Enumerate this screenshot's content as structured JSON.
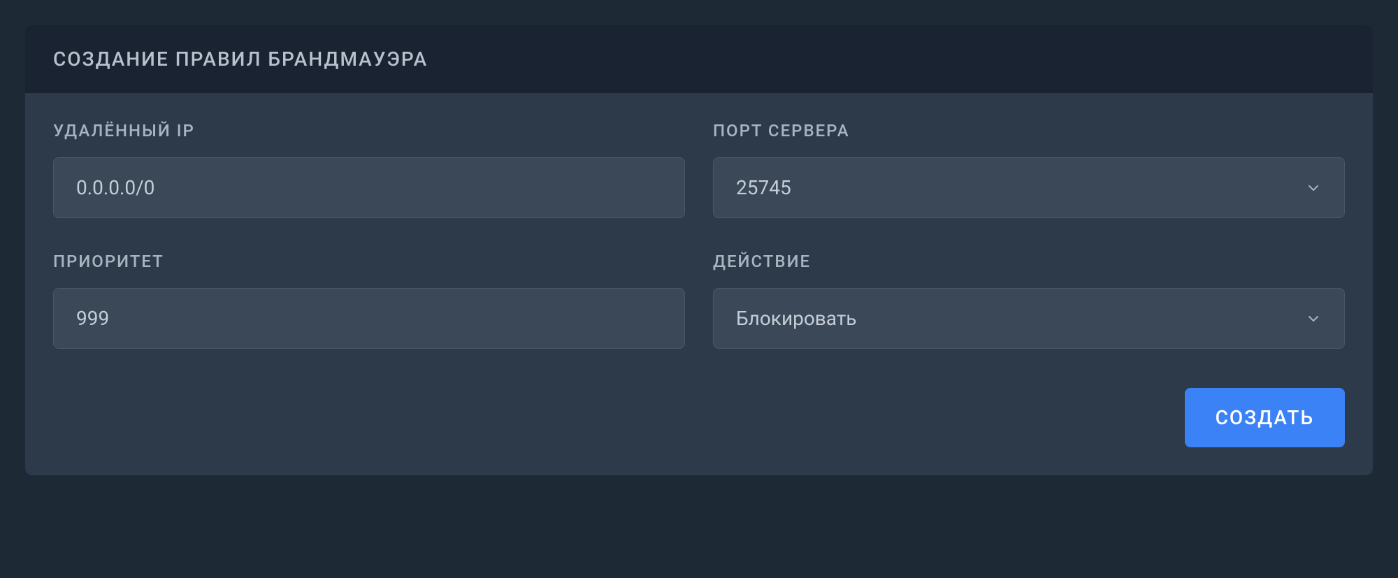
{
  "panel": {
    "title": "СОЗДАНИЕ ПРАВИЛ БРАНДМАУЭРА"
  },
  "form": {
    "remote_ip": {
      "label": "УДАЛЁННЫЙ IP",
      "value": "0.0.0.0/0"
    },
    "server_port": {
      "label": "ПОРТ СЕРВЕРА",
      "selected": "25745"
    },
    "priority": {
      "label": "ПРИОРИТЕТ",
      "value": "999"
    },
    "action": {
      "label": "ДЕЙСТВИЕ",
      "selected": "Блокировать"
    }
  },
  "buttons": {
    "create": "СОЗДАТЬ"
  }
}
